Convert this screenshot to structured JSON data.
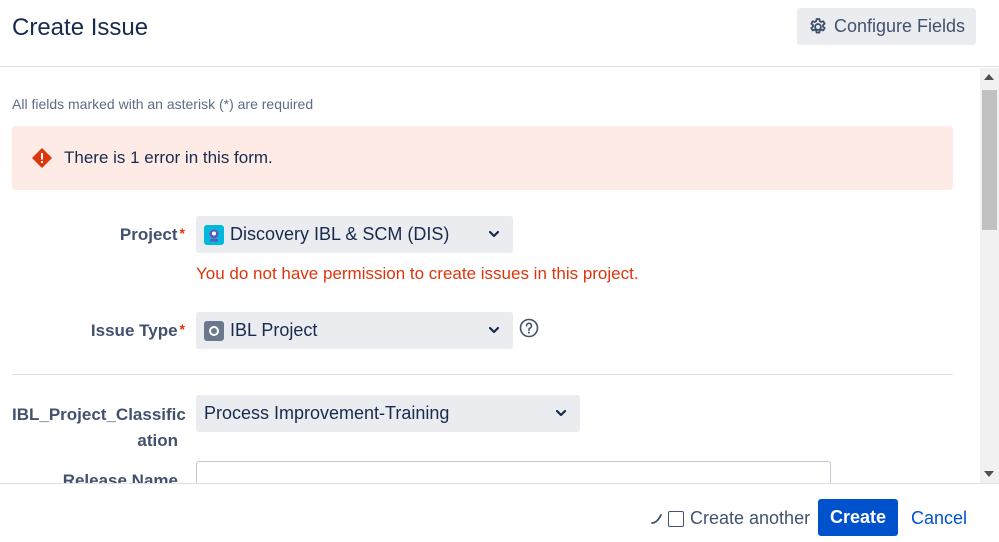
{
  "dialog": {
    "title": "Create Issue",
    "configure_label": "Configure Fields"
  },
  "form": {
    "required_note": "All fields marked with an asterisk (*) are required",
    "error_banner": "There is 1 error in this form.",
    "required_marker": "*",
    "project": {
      "label": "Project",
      "value": "Discovery IBL & SCM (DIS)",
      "error": "You do not have permission to create issues in this project."
    },
    "issue_type": {
      "label": "Issue Type",
      "value": "IBL Project"
    },
    "classification": {
      "label_line1": "IBL_Project_Classific",
      "label_line2": "ation",
      "value": "Process Improvement-Training"
    },
    "release_name": {
      "label": "Release Name",
      "value": ""
    }
  },
  "footer": {
    "create_another_label": "Create another",
    "create_label": "Create",
    "cancel_label": "Cancel"
  },
  "colors": {
    "primary": "#0052cc",
    "error": "#de350b",
    "error_bg": "#ffebe6"
  }
}
